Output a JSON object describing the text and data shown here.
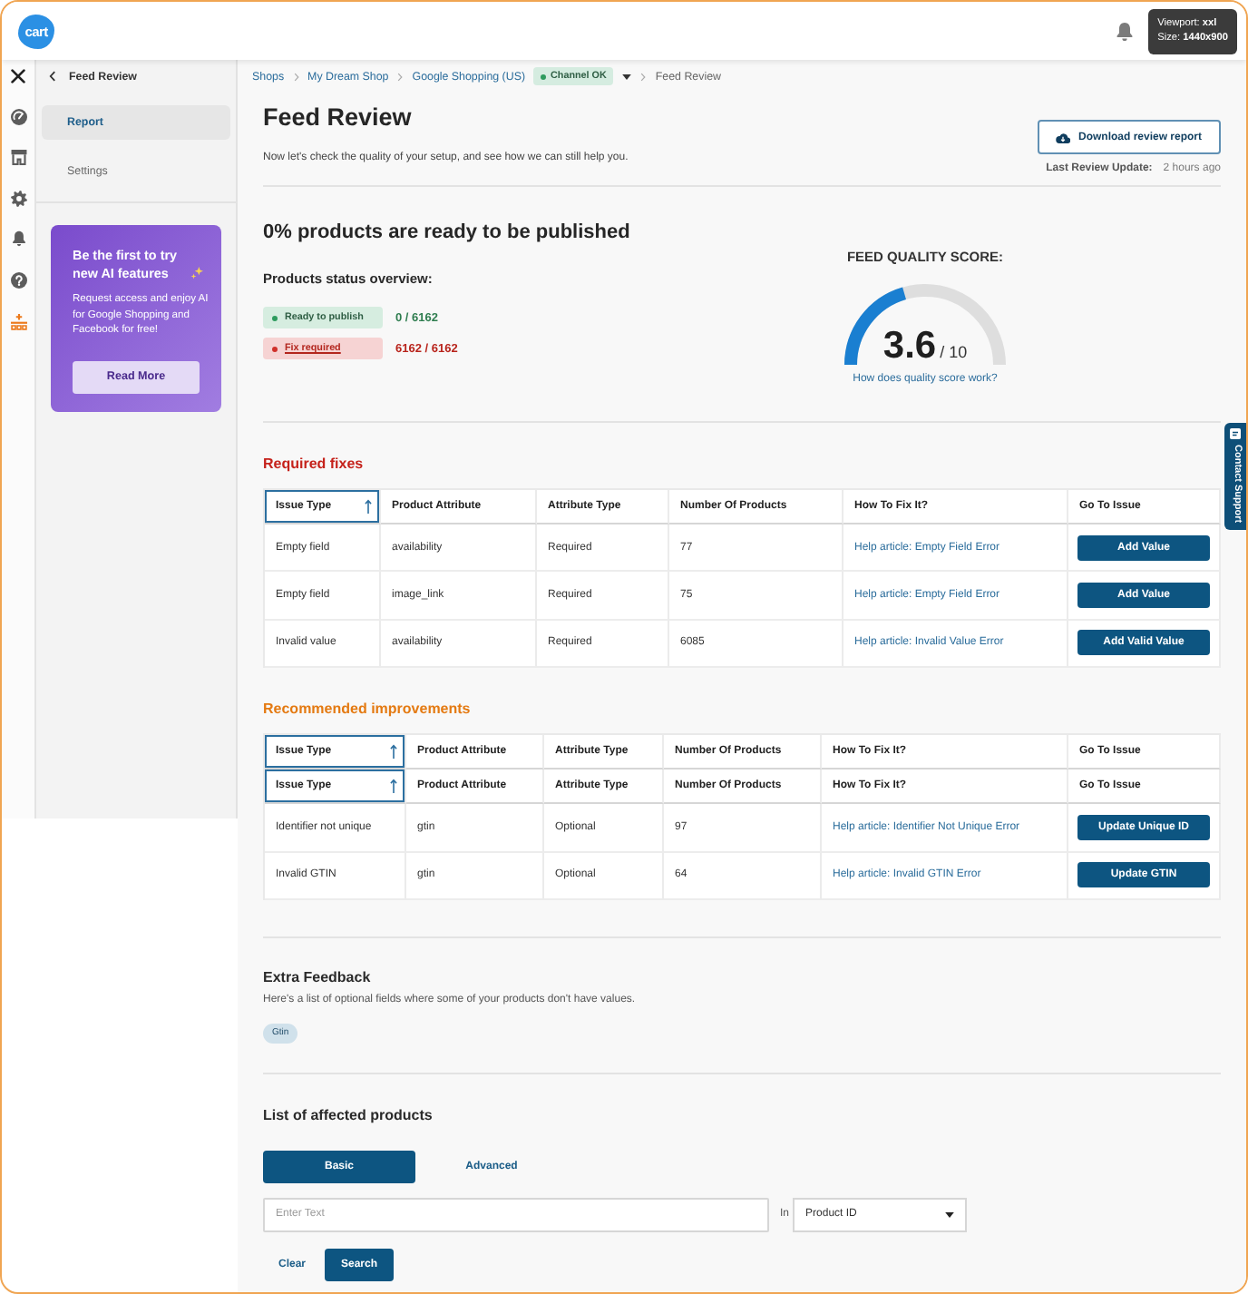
{
  "top_bar": {
    "logo": "cart",
    "tooltip": [
      "Viewport: **xxl**",
      "Size: **1440x900**"
    ]
  },
  "rail": {
    "items": [
      {
        "kind": "gauge",
        "selected": false
      },
      {
        "kind": "store",
        "selected": false
      },
      {
        "kind": "gear",
        "selected": false
      },
      {
        "kind": "bell",
        "selected": false
      },
      {
        "kind": "help",
        "selected": false
      },
      {
        "kind": "stack",
        "selected": true
      }
    ]
  },
  "sidebar": {
    "back_label": "Feed Review",
    "items": [
      {
        "label": "Report",
        "selected": true
      },
      {
        "label": "Settings",
        "selected": false
      }
    ],
    "promo": {
      "title": "Be the first to try new AI features",
      "text": "Request access and enjoy AI for Google Shopping and Facebook for free!",
      "button": "Read More"
    }
  },
  "breadcrumb": {
    "items": [
      {
        "label": "Shops",
        "current": false
      },
      {
        "label": "My Dream Shop",
        "current": false
      },
      {
        "label": "Google Shopping (US)",
        "current": false,
        "status": {
          "label": "Channel OK",
          "kind": "ok"
        }
      },
      {
        "label": "Feed Review",
        "current": true
      }
    ]
  },
  "page": {
    "title": "Feed Review",
    "subtitle": "Now let's check the quality of your setup, and see how we can still help you.",
    "download_button": "Download review report",
    "last_update": {
      "label": "Last Review Update:",
      "value": "2 hours ago"
    }
  },
  "summary": {
    "headline": "0% products are ready to be published",
    "overview_title": "Products status overview:",
    "statuses": [
      {
        "kind": "ready",
        "label": "Ready to publish",
        "count": "0 / 6162"
      },
      {
        "kind": "error",
        "label": "Fix required",
        "count": "6162 / 6162"
      }
    ]
  },
  "quality_score": {
    "title": "FEED QUALITY SCORE:",
    "score": "3.6",
    "max": "/ 10",
    "level": 0.36,
    "link": "How does quality score work?"
  },
  "required_fixes": {
    "title": "Required fixes",
    "header_rows": [
      [
        {
          "label": "Issue Type",
          "sorted": true
        },
        {
          "label": "Product Attribute",
          "sorted": false
        },
        {
          "label": "Attribute Type",
          "sorted": false
        },
        {
          "label": "Number Of Products",
          "sorted": false
        },
        {
          "label": "How To Fix It?",
          "sorted": false
        },
        {
          "label": "Go To Issue",
          "sorted": false
        }
      ]
    ],
    "rows": [
      {
        "issue_type": "Empty field",
        "product_attribute": "availability",
        "attribute_type": "Required",
        "number_of_products": "77",
        "how_to_fix": "Help article: Empty Field Error",
        "go_to_issue": "Add Value"
      },
      {
        "issue_type": "Empty field",
        "product_attribute": "image_link",
        "attribute_type": "Required",
        "number_of_products": "75",
        "how_to_fix": "Help article: Empty Field Error",
        "go_to_issue": "Add Value"
      },
      {
        "issue_type": "Invalid value",
        "product_attribute": "availability",
        "attribute_type": "Required",
        "number_of_products": "6085",
        "how_to_fix": "Help article: Invalid Value Error",
        "go_to_issue": "Add Valid Value"
      }
    ]
  },
  "recommended_improvements": {
    "title": "Recommended improvements",
    "header_rows": [
      [
        {
          "label": "Issue Type",
          "sorted": true
        },
        {
          "label": "Product Attribute",
          "sorted": false
        },
        {
          "label": "Attribute Type",
          "sorted": false
        },
        {
          "label": "Number Of Products",
          "sorted": false
        },
        {
          "label": "How To Fix It?",
          "sorted": false
        },
        {
          "label": "Go To Issue",
          "sorted": false
        }
      ],
      [
        {
          "label": "Issue Type",
          "sorted": true
        },
        {
          "label": "Product Attribute",
          "sorted": false
        },
        {
          "label": "Attribute Type",
          "sorted": false
        },
        {
          "label": "Number Of Products",
          "sorted": false
        },
        {
          "label": "How To Fix It?",
          "sorted": false
        },
        {
          "label": "Go To Issue",
          "sorted": false
        }
      ]
    ],
    "rows": [
      {
        "issue_type": "Identifier not unique",
        "product_attribute": "gtin",
        "attribute_type": "Optional",
        "number_of_products": "97",
        "how_to_fix": "Help article: Identifier Not Unique Error",
        "go_to_issue": "Update Unique ID"
      },
      {
        "issue_type": "Invalid GTIN",
        "product_attribute": "gtin",
        "attribute_type": "Optional",
        "number_of_products": "64",
        "how_to_fix": "Help article: Invalid GTIN Error",
        "go_to_issue": "Update GTIN"
      }
    ]
  },
  "extra_feedback": {
    "title": "Extra Feedback",
    "text": "Here's a list of optional fields where some of your products don't have values.",
    "tags": [
      "Gtin"
    ]
  },
  "affected_products": {
    "title": "List of affected products",
    "tabs": [
      {
        "label": "Basic",
        "selected": true
      },
      {
        "label": "Advanced",
        "selected": false
      }
    ],
    "search": {
      "placeholder": "Enter Text"
    },
    "in_label": "In",
    "field_select": {
      "value": "Product ID"
    },
    "clear_button": "Clear",
    "search_button": "Search"
  },
  "contact_support": {
    "label": "Contact Support"
  }
}
